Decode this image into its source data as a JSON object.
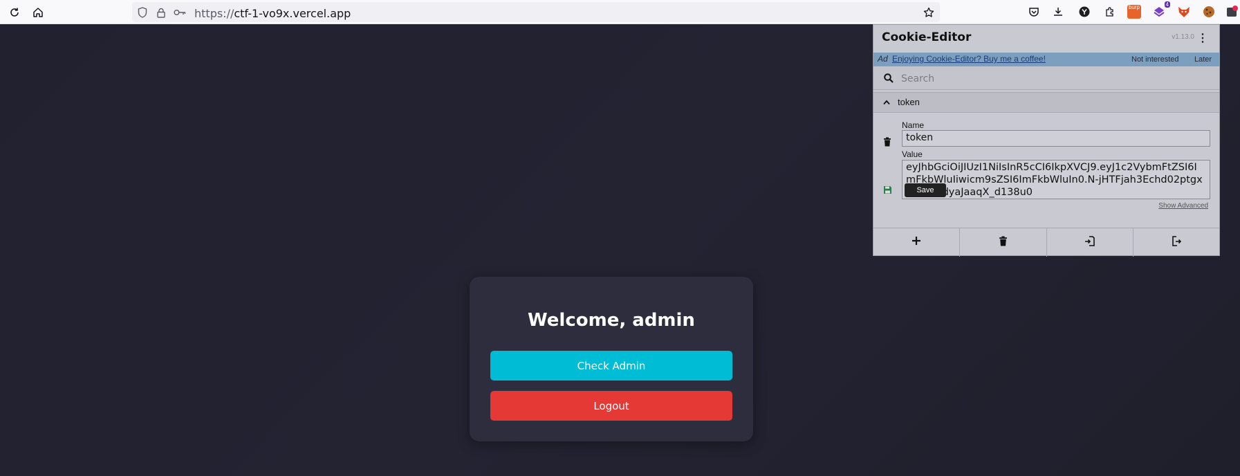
{
  "browser": {
    "url_scheme": "https://",
    "url_host": "ctf-1-vo9x.vercel.app",
    "extensions": {
      "burp_label": "burp",
      "badge_count": "4"
    }
  },
  "page": {
    "welcome": "Welcome, admin",
    "check_admin_label": "Check Admin",
    "logout_label": "Logout",
    "colors": {
      "background": "#20202e",
      "card": "#2d2d3e",
      "check_admin": "#00bcd4",
      "logout": "#e53935"
    }
  },
  "cookie_editor": {
    "title": "Cookie-Editor",
    "version": "v1.13.0",
    "ad": {
      "tag": "Ad",
      "link_text": "Enjoying Cookie-Editor? Buy me a coffee!",
      "not_interested": "Not interested",
      "later": "Later"
    },
    "search_placeholder": "Search",
    "cookie": {
      "row_name": "token",
      "name_label": "Name",
      "name_value": "token",
      "value_label": "Value",
      "value": "eyJhbGciOiJIUzI1NiIsInR5cCI6IkpXVCJ9.eyJ1c2VybmFtZSI6ImFkbWluIiwicm9sZSI6ImFkbWluIn0.N-jHTFjah3Echd02ptgxak5DbrdyaJaaqX_d138u0",
      "save_tooltip": "Save",
      "show_advanced": "Show Advanced"
    }
  }
}
